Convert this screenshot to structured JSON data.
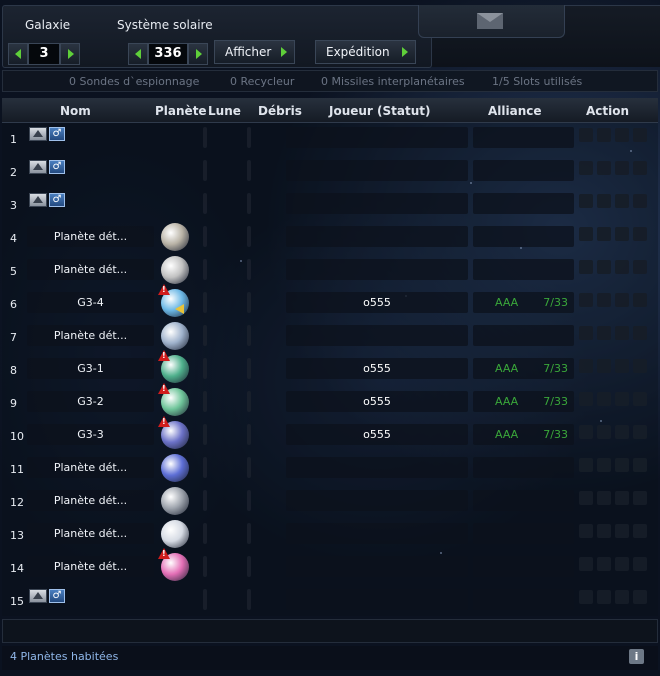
{
  "nav": {
    "galaxy_label": "Galaxie",
    "system_label": "Système solaire",
    "galaxy_value": "3",
    "system_value": "336",
    "show_button": "Afficher",
    "expedition_button": "Expédition"
  },
  "info": {
    "probes": "0 Sondes d`espionnage",
    "recyclers": "0 Recycleur",
    "missiles": "0 Missiles interplanétaires",
    "slots": "1/5 Slots utilisés"
  },
  "table": {
    "headers": {
      "name": "Nom",
      "planet": "Planète",
      "moon": "Lune",
      "debris": "Débris",
      "player": "Joueur (Statut)",
      "alliance": "Alliance",
      "action": "Action"
    },
    "rows": [
      {
        "pos": "1",
        "name": "",
        "player": "",
        "alliance": "",
        "rank": "",
        "planet": null
      },
      {
        "pos": "2",
        "name": "",
        "player": "",
        "alliance": "",
        "rank": "",
        "planet": null
      },
      {
        "pos": "3",
        "name": "",
        "player": "",
        "alliance": "",
        "rank": "",
        "planet": null
      },
      {
        "pos": "4",
        "name": "Planète dét...",
        "player": "",
        "alliance": "",
        "rank": "",
        "planet": "#b9b3a6"
      },
      {
        "pos": "5",
        "name": "Planète dét...",
        "player": "",
        "alliance": "",
        "rank": "",
        "planet": "#c2c2c2"
      },
      {
        "pos": "6",
        "name": "G3-4",
        "player": "o555",
        "alliance": "AAA",
        "rank": "7/33",
        "planet": "#6cb8e6"
      },
      {
        "pos": "7",
        "name": "Planète dét...",
        "player": "",
        "alliance": "",
        "rank": "",
        "planet": "#9fb2cc"
      },
      {
        "pos": "8",
        "name": "G3-1",
        "player": "o555",
        "alliance": "AAA",
        "rank": "7/33",
        "planet": "#4fb08c"
      },
      {
        "pos": "9",
        "name": "G3-2",
        "player": "o555",
        "alliance": "AAA",
        "rank": "7/33",
        "planet": "#6fc59a"
      },
      {
        "pos": "10",
        "name": "G3-3",
        "player": "o555",
        "alliance": "AAA",
        "rank": "7/33",
        "planet": "#6c72c8"
      },
      {
        "pos": "11",
        "name": "Planète dét...",
        "player": "",
        "alliance": "",
        "rank": "",
        "planet": "#5e6fd6"
      },
      {
        "pos": "12",
        "name": "Planète dét...",
        "player": "",
        "alliance": "",
        "rank": "",
        "planet": "#9ea4ad"
      },
      {
        "pos": "13",
        "name": "Planète dét...",
        "player": "",
        "alliance": "",
        "rank": "",
        "planet": "#d6dbe4"
      },
      {
        "pos": "14",
        "name": "Planète dét...",
        "player": "",
        "alliance": "",
        "rank": "",
        "planet": "#e46fb6"
      },
      {
        "pos": "15",
        "name": "",
        "player": "",
        "alliance": "",
        "rank": "",
        "planet": null
      }
    ]
  },
  "footer": {
    "inhabited": "4 Planètes habitées",
    "info_icon": "i"
  },
  "colors": {
    "arrow_green": "#5fcf3a",
    "alliance_green": "#3aa83a",
    "warning_red": "#d01c1c",
    "footer_blue": "#8fb6e8"
  }
}
